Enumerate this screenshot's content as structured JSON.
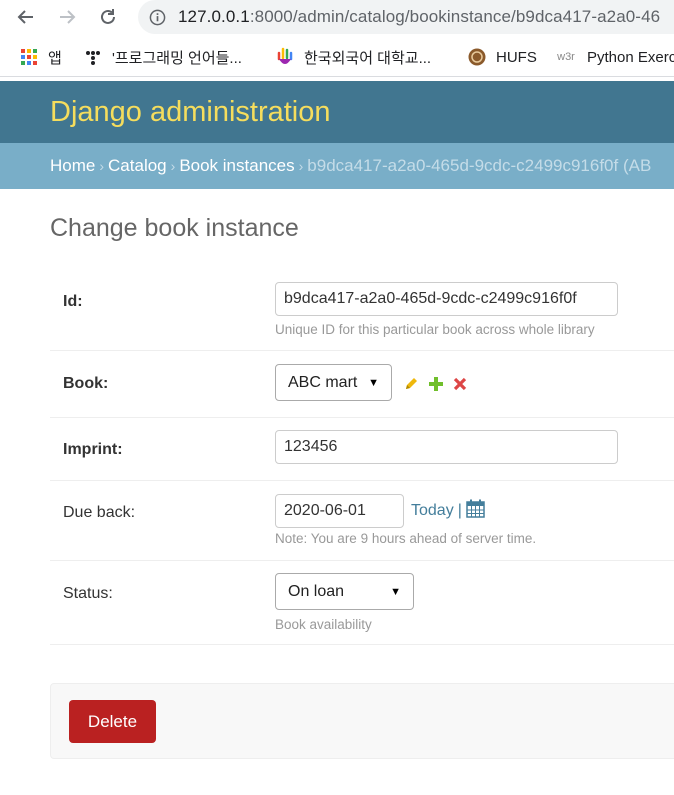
{
  "browser": {
    "url_host": "127.0.0.1",
    "url_rest": ":8000/admin/catalog/bookinstance/b9dca417-a2a0-46",
    "bookmarks": [
      {
        "label": "앱",
        "icon": "apps-grid-icon"
      },
      {
        "label": "'프로그래밍 언어들...",
        "icon": "bookmark-dots-icon"
      },
      {
        "label": "한국외국어 대학교...",
        "icon": "hand-logo-icon"
      },
      {
        "label": "HUFS",
        "icon": "hufs-logo-icon"
      },
      {
        "label": "Python Exerc",
        "icon": "w3r-logo-icon"
      }
    ],
    "w3r_text": "w3r"
  },
  "header": {
    "brand": "Django administration",
    "accent_color": "#417690",
    "brand_color": "#f5dd5d"
  },
  "breadcrumbs": {
    "home": "Home",
    "catalog": "Catalog",
    "section": "Book instances",
    "current": "b9dca417-a2a0-465d-9cdc-c2499c916f0f (AB",
    "sep": "›"
  },
  "page": {
    "title": "Change book instance"
  },
  "form": {
    "id": {
      "label": "Id:",
      "value": "b9dca417-a2a0-465d-9cdc-c2499c916f0f",
      "help": "Unique ID for this particular book across whole library"
    },
    "book": {
      "label": "Book:",
      "selected": "ABC mart"
    },
    "imprint": {
      "label": "Imprint:",
      "value": "123456"
    },
    "due_back": {
      "label": "Due back:",
      "value": "2020-06-01",
      "today": "Today",
      "pipe": "|",
      "note": "Note: You are 9 hours ahead of server time."
    },
    "status": {
      "label": "Status:",
      "selected": "On loan",
      "help": "Book availability"
    }
  },
  "actions": {
    "delete_label": "Delete",
    "delete_color": "#ba2121"
  }
}
